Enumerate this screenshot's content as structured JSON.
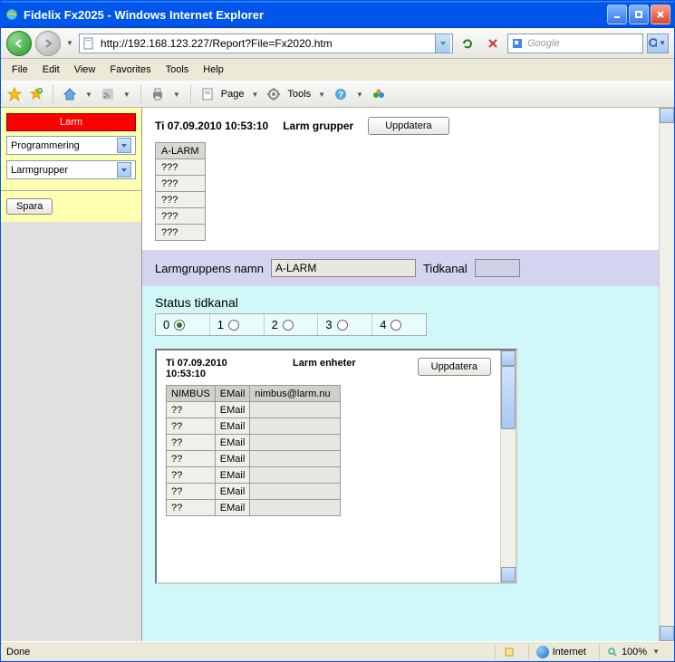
{
  "window": {
    "title": "Fidelix Fx2025 - Windows Internet Explorer"
  },
  "address": {
    "url": "http://192.168.123.227/Report?File=Fx2020.htm"
  },
  "search": {
    "placeholder": "Google"
  },
  "menu": {
    "file": "File",
    "edit": "Edit",
    "view": "View",
    "favorites": "Favorites",
    "tools": "Tools",
    "help": "Help"
  },
  "toolbar": {
    "page": "Page",
    "tools": "Tools"
  },
  "sidebar": {
    "larm": "Larm",
    "select1": "Programmering",
    "select2": "Larmgrupper",
    "spara": "Spara"
  },
  "main": {
    "timestamp": "Ti 07.09.2010 10:53:10",
    "heading": "Larm grupper",
    "update": "Uppdatera",
    "groups": [
      "A-LARM",
      "???",
      "???",
      "???",
      "???",
      "???"
    ],
    "name_label": "Larmgruppens namn",
    "name_value": "A-LARM",
    "tidkanal_label": "Tidkanal",
    "status_label": "Status tidkanal",
    "radios": [
      "0",
      "1",
      "2",
      "3",
      "4"
    ],
    "radio_selected": 0,
    "inner": {
      "timestamp": "Ti 07.09.2010 10:53:10",
      "heading": "Larm enheter",
      "update": "Uppdatera",
      "rows": [
        {
          "c0": "NIMBUS",
          "c1": "EMail",
          "c2": "nimbus@larm.nu"
        },
        {
          "c0": "??",
          "c1": "EMail",
          "c2": ""
        },
        {
          "c0": "??",
          "c1": "EMail",
          "c2": ""
        },
        {
          "c0": "??",
          "c1": "EMail",
          "c2": ""
        },
        {
          "c0": "??",
          "c1": "EMail",
          "c2": ""
        },
        {
          "c0": "??",
          "c1": "EMail",
          "c2": ""
        },
        {
          "c0": "??",
          "c1": "EMail",
          "c2": ""
        },
        {
          "c0": "??",
          "c1": "EMail",
          "c2": ""
        }
      ]
    }
  },
  "status": {
    "done": "Done",
    "zone": "Internet",
    "zoom": "100%"
  }
}
